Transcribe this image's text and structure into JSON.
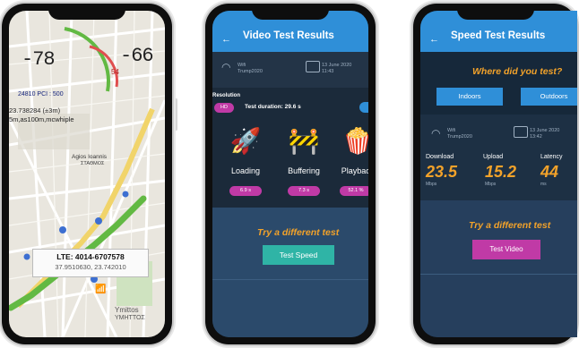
{
  "phone1": {
    "signal_left": "-78",
    "signal_right": "-66",
    "signal_small": "54",
    "cell_line": "24810      PCI : 500",
    "coords_line": "23.738284 (±3m)",
    "accuracy_line": "5m,as100m,mcwhiple",
    "place_1": "Agios Ioannis",
    "place_2": "ΣΤΑΘΜΟΣ",
    "lte_title": "LTE: 4014-6707578",
    "lte_coords": "37.9510630, 23.742010",
    "district": "Ymittos",
    "district_gr": "ΥΜΗΤΤΟΣ",
    "colors": {
      "route": "#62b943",
      "road": "#f1d46a"
    }
  },
  "phone2": {
    "title": "Video Test Results",
    "network_type": "Wifi",
    "network_name": "Trump2020",
    "date": "13 June 2020",
    "time": "11:43",
    "resolution_label": "Resolution",
    "resolution_value": "HD",
    "test_duration": "Test duration: 29.6 s",
    "metrics": [
      {
        "label": "Loading",
        "value": "6.9 s",
        "icon": "rocket-icon"
      },
      {
        "label": "Buffering",
        "value": "7.3 s",
        "icon": "barrier-icon"
      },
      {
        "label": "Playback",
        "value": "52.1 %",
        "icon": "popcorn-icon"
      }
    ],
    "prompt": "Try a different test",
    "button": "Test Speed",
    "colors": {
      "accent": "#2fb4a6",
      "pill": "#c03aa6"
    }
  },
  "phone3": {
    "title": "Speed Test Results",
    "question": "Where did you test?",
    "indoors": "Indoors",
    "outdoors": "Outdoors",
    "network_type": "Wifi",
    "network_name": "Trump2020",
    "date": "13 June 2020",
    "time": "13:42",
    "download_label": "Download",
    "download_value": "23.5",
    "download_unit": "Mbps",
    "upload_label": "Upload",
    "upload_value": "15.2",
    "upload_unit": "Mbps",
    "latency_label": "Latency",
    "latency_value": "44",
    "latency_unit": "ms",
    "prompt": "Try a different test",
    "button": "Test Video",
    "colors": {
      "value": "#f2a22a",
      "button": "#c03aa6",
      "toggle": "#2f8fd8"
    }
  }
}
